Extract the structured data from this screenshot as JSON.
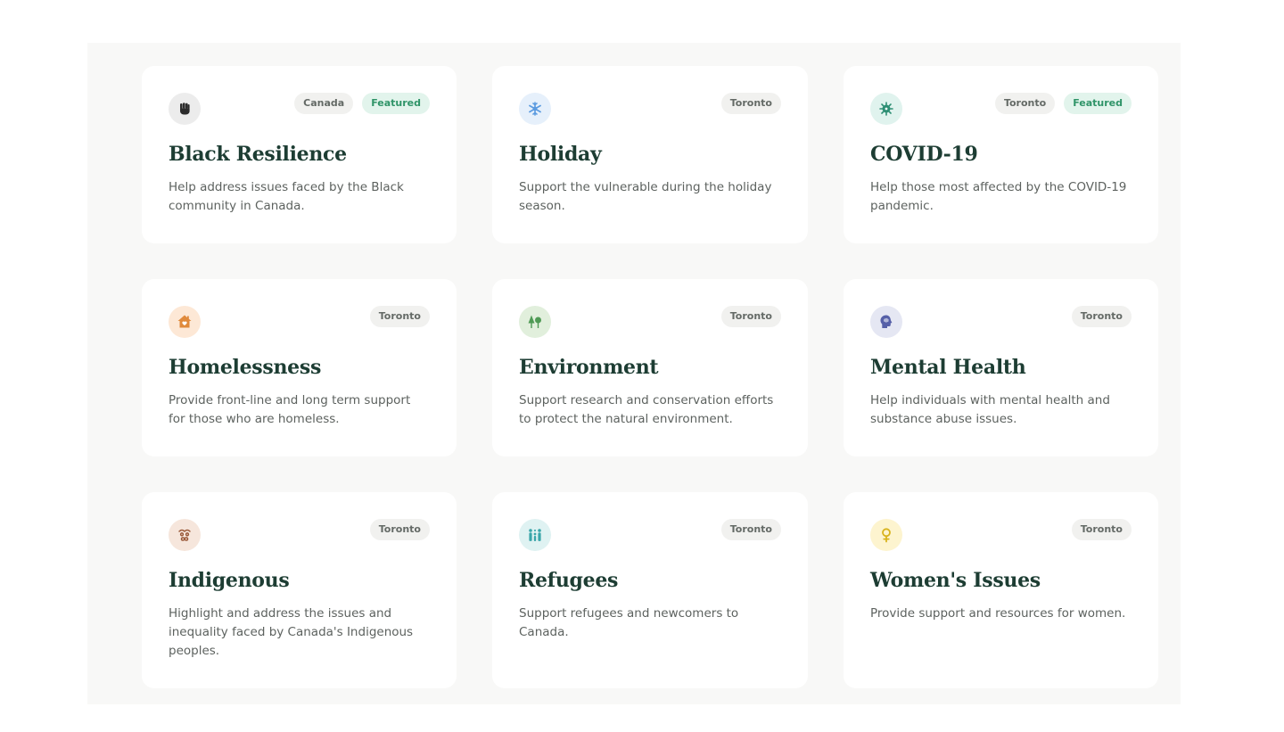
{
  "cards": [
    {
      "title": "Black Resilience",
      "description": "Help address issues faced by the Black community in Canada.",
      "icon": "fist-icon",
      "icon_bg": "#ececec",
      "icon_color": "#2b2b2b",
      "tags": [
        "Canada",
        "Featured"
      ]
    },
    {
      "title": "Holiday",
      "description": "Support the vulnerable during the holiday season.",
      "icon": "snowflake-icon",
      "icon_bg": "#e6f0fb",
      "icon_color": "#5b9be0",
      "tags": [
        "Toronto"
      ]
    },
    {
      "title": "COVID-19",
      "description": "Help those most affected by the COVID-19 pandemic.",
      "icon": "virus-icon",
      "icon_bg": "#e0f3ee",
      "icon_color": "#2e8f74",
      "tags": [
        "Toronto",
        "Featured"
      ]
    },
    {
      "title": "Homelessness",
      "description": "Provide front-line and long term support for those who are homeless.",
      "icon": "house-heart-icon",
      "icon_bg": "#fde8d6",
      "icon_color": "#e08a3c",
      "tags": [
        "Toronto"
      ]
    },
    {
      "title": "Environment",
      "description": "Support research and conservation efforts to protect the natural environment.",
      "icon": "trees-icon",
      "icon_bg": "#e1efdc",
      "icon_color": "#4f9a55",
      "tags": [
        "Toronto"
      ]
    },
    {
      "title": "Mental Health",
      "description": "Help individuals with mental health and substance abuse issues.",
      "icon": "head-brain-icon",
      "icon_bg": "#e5e7f3",
      "icon_color": "#5660a8",
      "tags": [
        "Toronto"
      ]
    },
    {
      "title": "Indigenous",
      "description": "Highlight and address the issues and inequality faced by Canada's Indigenous peoples.",
      "icon": "infinity-icon",
      "icon_bg": "#f6e6dc",
      "icon_color": "#9a5a3a",
      "tags": [
        "Toronto"
      ]
    },
    {
      "title": "Refugees",
      "description": "Support refugees and newcomers to Canada.",
      "icon": "family-icon",
      "icon_bg": "#dff2f2",
      "icon_color": "#3aa6aa",
      "tags": [
        "Toronto"
      ]
    },
    {
      "title": "Women's Issues",
      "description": "Provide support and resources for women.",
      "icon": "female-symbol-icon",
      "icon_bg": "#fdf4cf",
      "icon_color": "#d8b31c",
      "tags": [
        "Toronto"
      ]
    }
  ]
}
